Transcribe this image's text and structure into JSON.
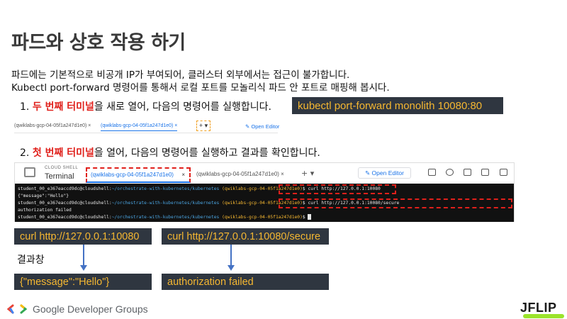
{
  "title": "파드와 상호 작용 하기",
  "desc": {
    "line1": "파드에는 기본적으로 비공개 IP가 부여되어, 클러스터 외부에서는 접근이 불가합니다.",
    "line2": "Kubectl port-forward 명령어를 통해서 로컬 포트를 모놀리식 파드 안 포트로 매핑해 봅시다."
  },
  "step1": {
    "num": "1.",
    "highlight": "두 번째 터미널",
    "rest": "을 새로 열어, 다음의 명령어를 실행합니다."
  },
  "step1_cmd": "kubectl port-forward monolith 10080:80",
  "mini_tabs": {
    "tab1": "(qwiklabs-gcp-04-05f1a247d1e0)  ×",
    "tab2": "(qwiklabs-gcp-04-05f1a247d1e0)  ×",
    "plus": "+ ▾",
    "open_editor": "✎ Open Editor"
  },
  "step2": {
    "num": "2.",
    "highlight": "첫 번째 터미널",
    "rest": "을 열어, 다음의 명령어를 실행하고 결과를 확인합니다."
  },
  "shell": {
    "label": "CLOUD SHELL",
    "terminal": "Terminal",
    "tab_active": "(qwiklabs-gcp-04-05f1a247d1e0)",
    "tab_close": "×",
    "tab_other": "(qwiklabs-gcp-04-05f1a247d1e0)  ×",
    "tab_plus": "+ ▾",
    "open_editor": "✎ Open Editor"
  },
  "terminal": {
    "prompt": "student_00_e367eaccd9dc@cloudshell:",
    "path": "~/orchestrate-with-kubernetes/kubernetes",
    "project": "(qwiklabs-gcp-04-05f1a247d1e0)",
    "cmd1": "$ curl http://127.0.0.1:10080",
    "out1": "{\"message\":\"Hello\"}",
    "cmd2": "$ curl http://127.0.0.1:10080/secure",
    "out2": "authorization failed",
    "cmd3": "$ "
  },
  "boxes": {
    "cmd_a": "curl http://127.0.0.1:10080",
    "cmd_b": "curl http://127.0.0.1:10080/secure",
    "result_label": "결과창",
    "res_a": "{\"message\":\"Hello\"}",
    "res_b": "authorization failed"
  },
  "footer": {
    "brand": "Google Developer Groups",
    "logo": "JFLIP"
  },
  "colors": {
    "accent_red": "#e0201b",
    "code_bg": "#2f3640",
    "code_text": "#f5b731",
    "arrow": "#4472c4",
    "jflip_green": "#9be32b"
  }
}
